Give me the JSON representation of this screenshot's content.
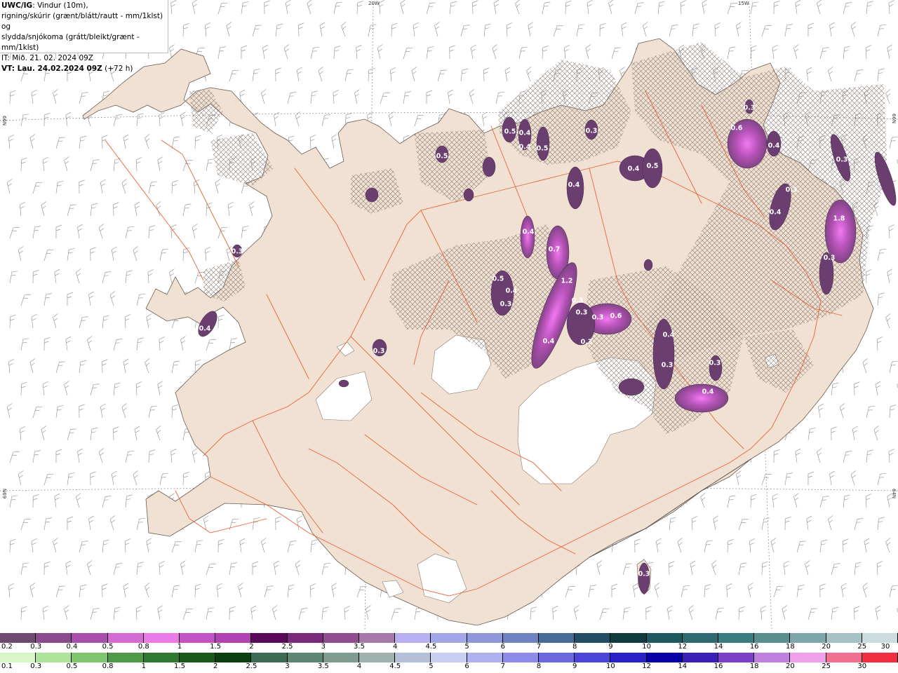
{
  "title": {
    "code": "UWC/IG",
    "line1": ": Vindur (10m),",
    "line2": "rigning/skúrir (grænt/blátt/rautt - mm/1klst) og",
    "line3": "slydda/snjókoma (grátt/bleikt/grænt - mm/1klst)",
    "it": "IT: Mið. 21. 02. 2024 09Z",
    "vt_bold": "VT: Lau. 24.02.2024 09Z",
    "vt_tail": " (+72 h)"
  },
  "coords": {
    "top_left": "20W",
    "top_right": "15W",
    "left_upper": "66N",
    "left_lower": "N69",
    "right_upper": "66N",
    "right_lower": "64N"
  },
  "colors": {
    "land": "#f1e1d2",
    "sea": "#ffffff",
    "roads": "#e8633a",
    "precip_light": "#6a3f6f",
    "precip_mid": "#b652b8",
    "precip_high": "#f27af0"
  },
  "precip_labels": [
    {
      "text": "0.5"
    },
    {
      "text": "0.4"
    },
    {
      "text": "0.4"
    },
    {
      "text": "0.5"
    },
    {
      "text": "0.3"
    },
    {
      "text": "0.4"
    },
    {
      "text": "0.5"
    },
    {
      "text": "0.4"
    },
    {
      "text": "0.6"
    },
    {
      "text": "0.4"
    },
    {
      "text": "0.3"
    },
    {
      "text": "0.3"
    },
    {
      "text": "0.3"
    },
    {
      "text": "0.4"
    },
    {
      "text": "0.3"
    },
    {
      "text": "1.8"
    },
    {
      "text": "0.4"
    },
    {
      "text": "0.7"
    },
    {
      "text": "1.2"
    },
    {
      "text": "0.3"
    },
    {
      "text": "0.3"
    },
    {
      "text": "0.3"
    },
    {
      "text": "0.6"
    },
    {
      "text": "0.4"
    },
    {
      "text": "0.3"
    },
    {
      "text": "0.5"
    },
    {
      "text": "0.4"
    },
    {
      "text": "0.3"
    },
    {
      "text": "0.4"
    },
    {
      "text": "0.3"
    },
    {
      "text": "0.3"
    },
    {
      "text": "0.4"
    },
    {
      "text": "0.3"
    },
    {
      "text": "0.5"
    },
    {
      "text": "0.3"
    },
    {
      "text": "0.4"
    },
    {
      "text": "0.3"
    }
  ],
  "scale_snow": {
    "labels": [
      "0.2",
      "0.3",
      "0.4",
      "0.5",
      "0.8",
      "1",
      "1.5",
      "2",
      "2.5",
      "3",
      "3.5",
      "4",
      "4.5",
      "5",
      "6",
      "7",
      "8",
      "9",
      "10",
      "12",
      "14",
      "16",
      "18",
      "20",
      "25",
      "30"
    ],
    "colors": [
      "#6e4a70",
      "#8a4b8c",
      "#a84fab",
      "#d46bd3",
      "#ea7ae6",
      "#c352c4",
      "#b042b2",
      "#5a0a58",
      "#7a2a7a",
      "#8f4d90",
      "#a57aa8",
      "#b9b0f2",
      "#a2a6e6",
      "#8e98d8",
      "#6f83c0",
      "#4a6a98",
      "#234d64",
      "#0f3a40",
      "#205860",
      "#2f6a70",
      "#3b7c80",
      "#5a8f92",
      "#7fa6a8",
      "#a6c2c4",
      "#cbdcdc"
    ]
  },
  "scale_rain": {
    "labels": [
      "0.1",
      "0.3",
      "0.5",
      "0.8",
      "1",
      "1.5",
      "2",
      "2.5",
      "3",
      "3.5",
      "4",
      "4.5",
      "5",
      "6",
      "7",
      "8",
      "9",
      "10",
      "12",
      "14",
      "16",
      "18",
      "20",
      "25",
      "30"
    ],
    "colors": [
      "#d8f6c8",
      "#aee39a",
      "#7fc56e",
      "#4f9a48",
      "#2f7a30",
      "#1a5a1c",
      "#0a4010",
      "#3d6a52",
      "#5e8674",
      "#7f9c90",
      "#9eb2ae",
      "#b4c0d8",
      "#c8cef0",
      "#b0b2f0",
      "#8e8cea",
      "#6c68e0",
      "#4a44d8",
      "#2a20c8",
      "#0a00a8",
      "#3a20b8",
      "#7a40c8",
      "#c080e0",
      "#f0a0e8",
      "#f07090",
      "#f03040"
    ]
  }
}
